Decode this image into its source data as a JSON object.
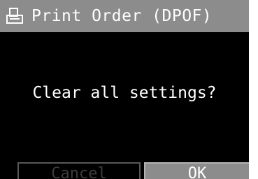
{
  "window": {
    "title": "Print Order (DPOF)",
    "icon": "printer-icon"
  },
  "dialog": {
    "message": "Clear all settings?"
  },
  "buttons": {
    "cancel_label": "Cancel",
    "ok_label": "OK",
    "selected": "OK"
  },
  "colors": {
    "title_bar": "#8c8c8c",
    "background": "#000000",
    "text": "#ffffff",
    "disabled_text": "#3c3c3c"
  }
}
